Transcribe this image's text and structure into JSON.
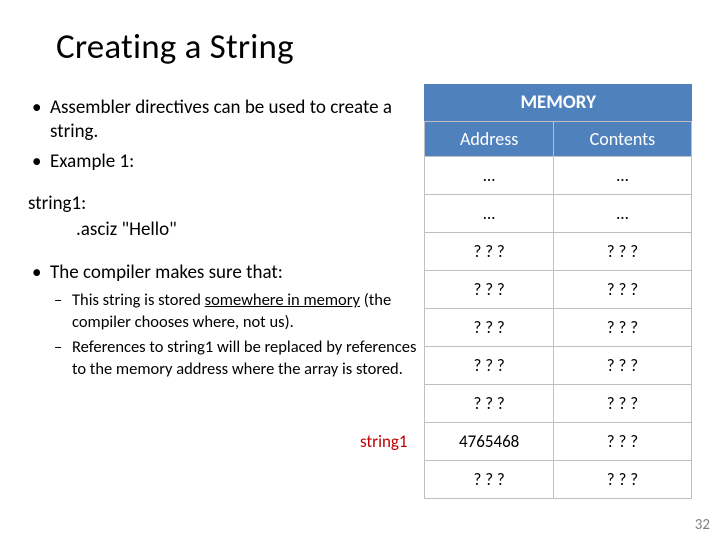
{
  "title": "Creating a String",
  "bullets1": [
    "Assembler directives can be used to create a string.",
    "Example 1:"
  ],
  "code": {
    "line1": "string1:",
    "line2": ".asciz \"Hello\""
  },
  "bullet2": "The compiler makes sure that:",
  "sub": [
    {
      "pre": "This string is stored ",
      "u": "somewhere in memory",
      "post": " (the compiler chooses where, not us)."
    },
    {
      "pre": "References to string1 will be replaced by references to the memory address where the array is stored.",
      "u": "",
      "post": ""
    }
  ],
  "string1_label": "string1",
  "memory": {
    "caption": "MEMORY",
    "h1": "Address",
    "h2": "Contents",
    "rows": [
      {
        "a": "…",
        "c": "…"
      },
      {
        "a": "…",
        "c": "…"
      },
      {
        "a": "? ? ?",
        "c": "? ? ?"
      },
      {
        "a": "? ? ?",
        "c": "? ? ?"
      },
      {
        "a": "? ? ?",
        "c": "? ? ?"
      },
      {
        "a": "? ? ?",
        "c": "? ? ?"
      },
      {
        "a": "? ? ?",
        "c": "? ? ?"
      },
      {
        "a": "4765468",
        "c": "? ? ?"
      },
      {
        "a": "? ? ?",
        "c": "? ? ?"
      }
    ]
  },
  "pagenum": "32"
}
